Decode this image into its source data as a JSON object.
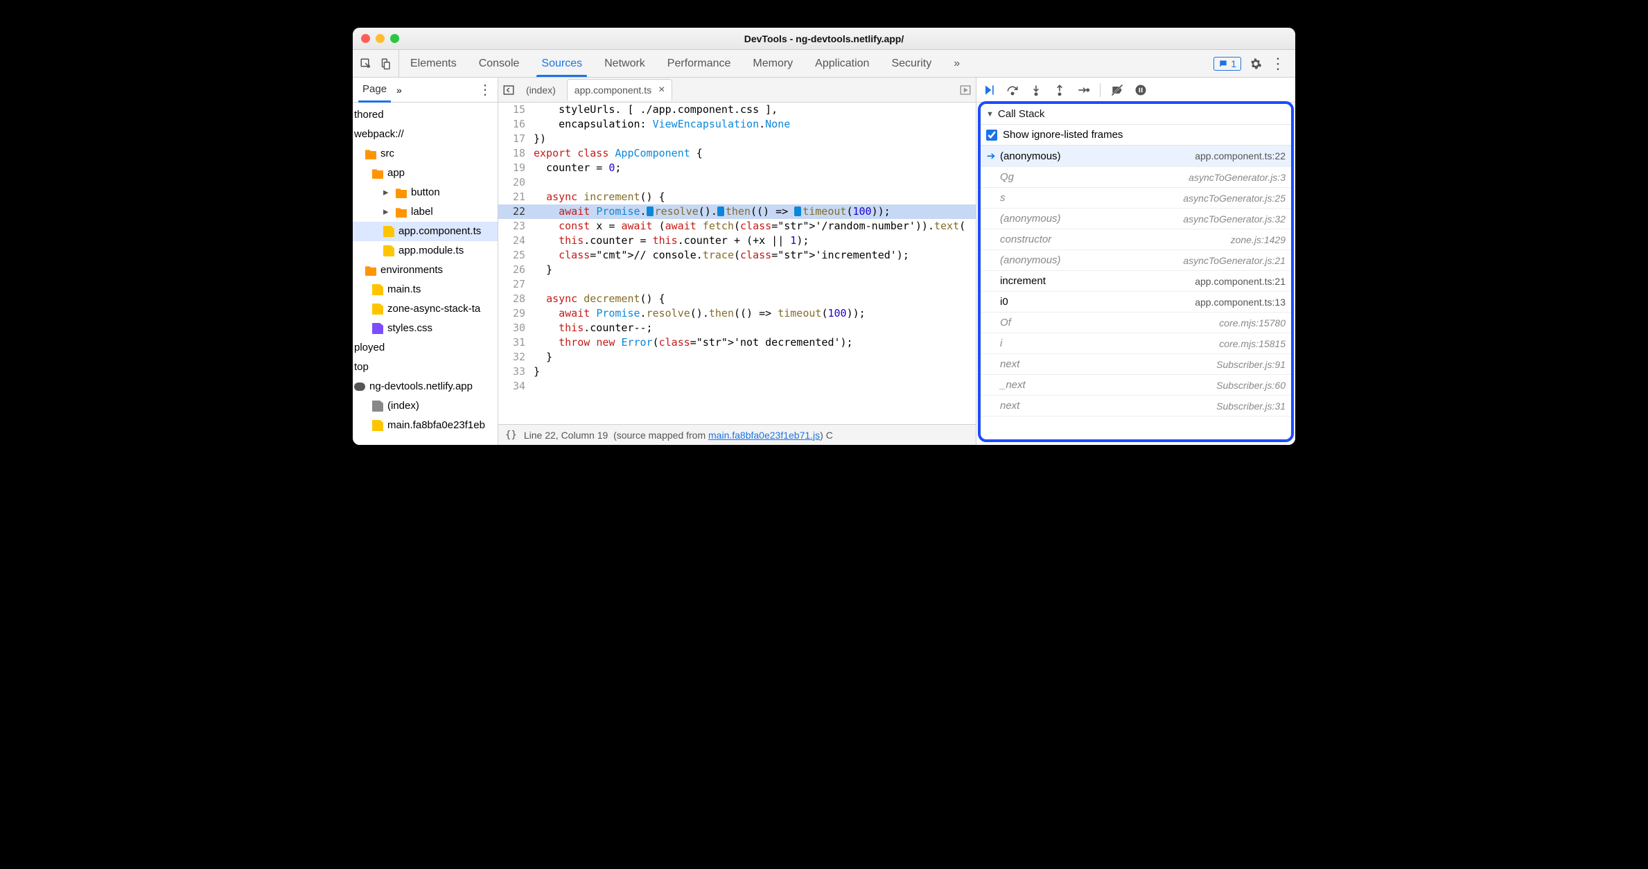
{
  "window_title": "DevTools - ng-devtools.netlify.app/",
  "tabs": [
    "Elements",
    "Console",
    "Sources",
    "Network",
    "Performance",
    "Memory",
    "Application",
    "Security"
  ],
  "active_tab": "Sources",
  "issues_count": "1",
  "nav": {
    "page_label": "Page",
    "items": [
      {
        "label": "thored",
        "kind": "text",
        "indent": 0
      },
      {
        "label": "webpack://",
        "kind": "text",
        "indent": 0
      },
      {
        "label": "src",
        "kind": "folder",
        "indent": 18
      },
      {
        "label": "app",
        "kind": "folder",
        "indent": 28
      },
      {
        "label": "button",
        "kind": "folder",
        "indent": 44,
        "twist": true
      },
      {
        "label": "label",
        "kind": "folder",
        "indent": 44,
        "twist": true
      },
      {
        "label": "app.component.ts",
        "kind": "file",
        "indent": 44,
        "selected": true
      },
      {
        "label": "app.module.ts",
        "kind": "file",
        "indent": 44
      },
      {
        "label": "environments",
        "kind": "folder",
        "indent": 18
      },
      {
        "label": "main.ts",
        "kind": "file",
        "indent": 28
      },
      {
        "label": "zone-async-stack-ta",
        "kind": "file",
        "indent": 28
      },
      {
        "label": "styles.css",
        "kind": "file",
        "indent": 28,
        "purple": true
      },
      {
        "label": "ployed",
        "kind": "text",
        "indent": 0
      },
      {
        "label": "top",
        "kind": "text",
        "indent": 0
      },
      {
        "label": "ng-devtools.netlify.app",
        "kind": "cloud",
        "indent": 0
      },
      {
        "label": "(index)",
        "kind": "file",
        "indent": 28,
        "gray": true
      },
      {
        "label": "main.fa8bfa0e23f1eb",
        "kind": "file",
        "indent": 28
      }
    ]
  },
  "editor": {
    "open_tabs": [
      {
        "label": "(index)",
        "active": false,
        "closable": false
      },
      {
        "label": "app.component.ts",
        "active": true,
        "closable": true
      }
    ],
    "first_line": 15,
    "current_line": 22,
    "lines": [
      "    styleUrls. [ ./app.component.css ],",
      "    encapsulation: ViewEncapsulation.None",
      "})",
      "export class AppComponent {",
      "  counter = 0;",
      "",
      "  async increment() {",
      "    await Promise.resolve().then(() => timeout(100));",
      "    const x = await (await fetch('/random-number')).text(",
      "    this.counter = this.counter + (+x || 1);",
      "    // console.trace('incremented');",
      "  }",
      "",
      "  async decrement() {",
      "    await Promise.resolve().then(() => timeout(100));",
      "    this.counter--;",
      "    throw new Error('not decremented');",
      "  }",
      "}",
      ""
    ],
    "status_line": "Line 22, Column 19",
    "status_map": "(source mapped from ",
    "status_link": "main.fa8bfa0e23f1eb71.js",
    "status_tail": ") C"
  },
  "debugger": {
    "section_title": "Call Stack",
    "show_ignored_label": "Show ignore-listed frames",
    "frames": [
      {
        "name": "(anonymous)",
        "loc": "app.component.ts:22",
        "current": true
      },
      {
        "name": "Qg",
        "loc": "asyncToGenerator.js:3",
        "ign": true
      },
      {
        "name": "s",
        "loc": "asyncToGenerator.js:25",
        "ign": true
      },
      {
        "name": "(anonymous)",
        "loc": "asyncToGenerator.js:32",
        "ign": true
      },
      {
        "name": "constructor",
        "loc": "zone.js:1429",
        "ign": true
      },
      {
        "name": "(anonymous)",
        "loc": "asyncToGenerator.js:21",
        "ign": true
      },
      {
        "name": "increment",
        "loc": "app.component.ts:21"
      },
      {
        "name": "i0",
        "loc": "app.component.ts:13"
      },
      {
        "name": "Of",
        "loc": "core.mjs:15780",
        "ign": true
      },
      {
        "name": "i",
        "loc": "core.mjs:15815",
        "ign": true
      },
      {
        "name": "next",
        "loc": "Subscriber.js:91",
        "ign": true
      },
      {
        "name": "_next",
        "loc": "Subscriber.js:60",
        "ign": true
      },
      {
        "name": "next",
        "loc": "Subscriber.js:31",
        "ign": true
      }
    ]
  }
}
